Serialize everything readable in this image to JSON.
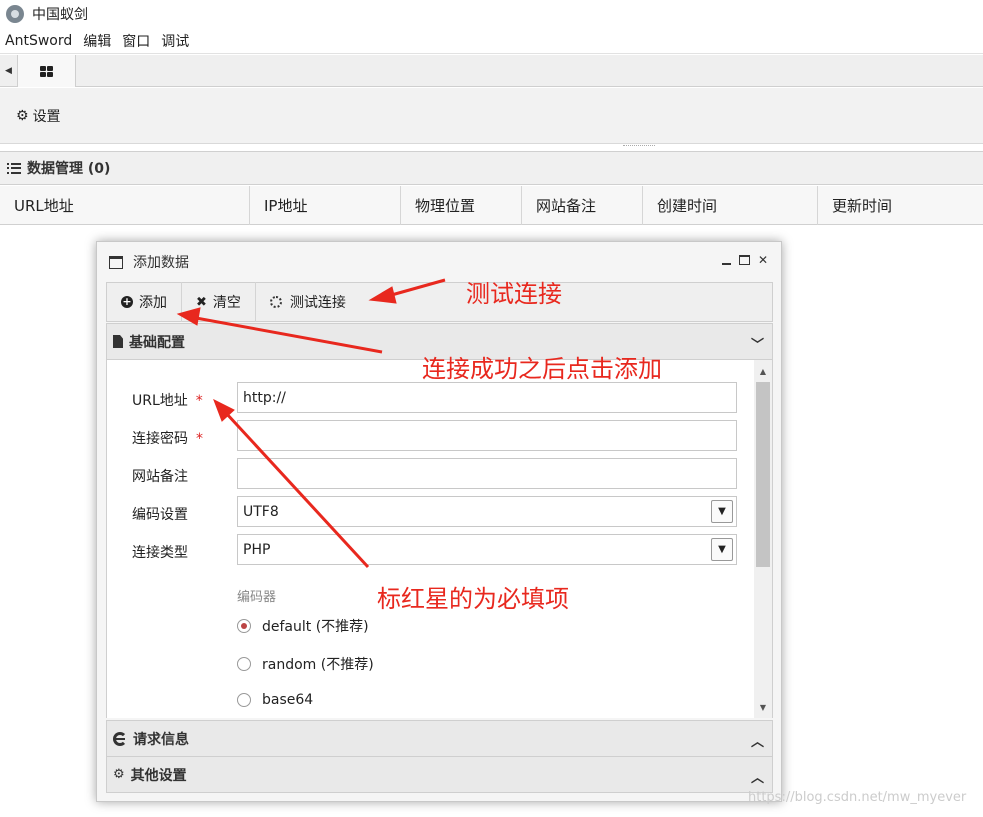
{
  "window": {
    "title": "中国蚁剑"
  },
  "menu": [
    "AntSword",
    "编辑",
    "窗口",
    "调试"
  ],
  "settings": {
    "label": "设置"
  },
  "data_manager": {
    "title": "数据管理 (0)"
  },
  "columns": [
    {
      "label": "URL地址"
    },
    {
      "label": "IP地址"
    },
    {
      "label": "物理位置"
    },
    {
      "label": "网站备注"
    },
    {
      "label": "创建时间"
    },
    {
      "label": "更新时间"
    }
  ],
  "dialog": {
    "title": "添加数据",
    "toolbar": {
      "add": "添加",
      "clear": "清空",
      "test": "测试连接"
    },
    "section_basic": "基础配置",
    "fields": {
      "url_label": "URL地址",
      "url_value": "http://",
      "password_label": "连接密码",
      "password_value": "",
      "remark_label": "网站备注",
      "remark_value": "",
      "encoding_label": "编码设置",
      "encoding_value": "UTF8",
      "type_label": "连接类型",
      "type_value": "PHP",
      "required_mark": "*"
    },
    "encoder": {
      "title": "编码器",
      "options": [
        "default (不推荐)",
        "random (不推荐)",
        "base64"
      ],
      "selected": "default (不推荐)"
    },
    "section_request": "请求信息",
    "section_other": "其他设置"
  },
  "annotations": {
    "test": "测试连接",
    "add": "连接成功之后点击添加",
    "required": "标红星的为必填项",
    "color": "#e8281e"
  },
  "watermark": "https://blog.csdn.net/mw_myever"
}
